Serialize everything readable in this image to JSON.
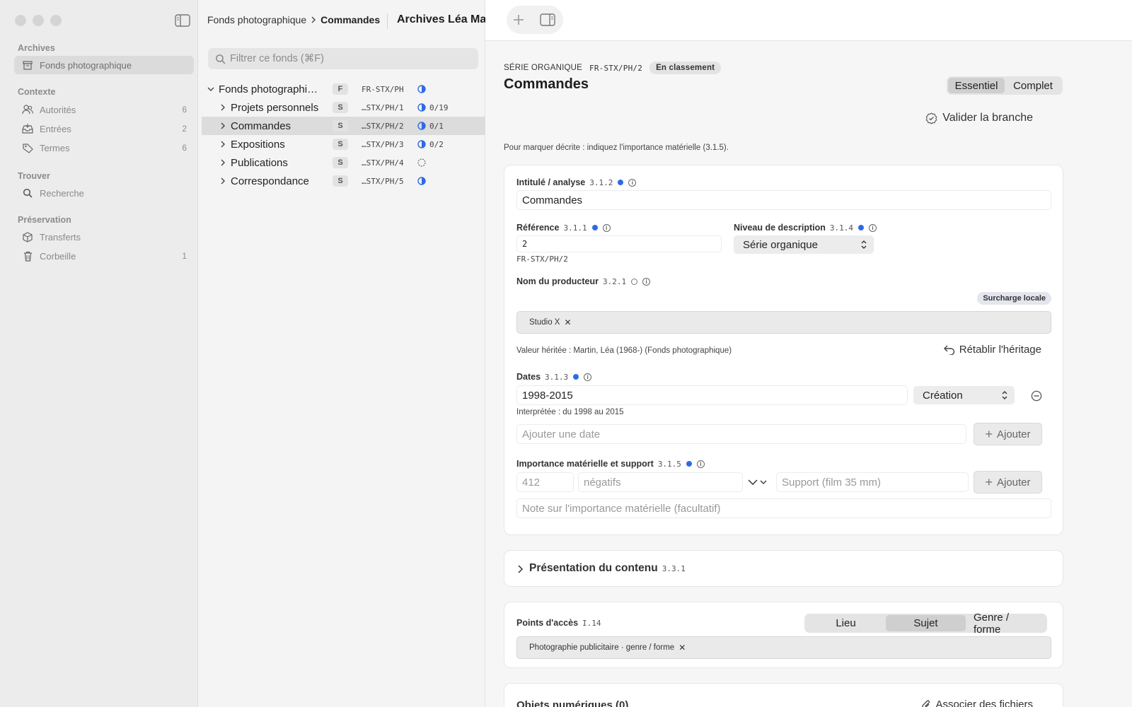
{
  "sidebar": {
    "sections": [
      {
        "heading": "Archives",
        "items": [
          {
            "label": "Fonds photographique",
            "icon": "archive-box-icon",
            "count": ""
          }
        ]
      },
      {
        "heading": "Contexte",
        "items": [
          {
            "label": "Autorités",
            "icon": "people-icon",
            "count": "6"
          },
          {
            "label": "Entrées",
            "icon": "inbox-tray-icon",
            "count": "2"
          },
          {
            "label": "Termes",
            "icon": "tag-icon",
            "count": "6"
          }
        ]
      },
      {
        "heading": "Trouver",
        "items": [
          {
            "label": "Recherche",
            "icon": "search-icon",
            "count": ""
          }
        ]
      },
      {
        "heading": "Préservation",
        "items": [
          {
            "label": "Transferts",
            "icon": "cube-icon",
            "count": ""
          },
          {
            "label": "Corbeille",
            "icon": "trash-icon",
            "count": "1"
          }
        ]
      }
    ]
  },
  "breadcrumb": {
    "parent": "Fonds photographique",
    "current": "Commandes"
  },
  "window_title": "Archives Léa Martin",
  "tree": {
    "search_placeholder": "Filtrer ce fonds (⌘F)",
    "rows": [
      {
        "name": "Fonds photographi…",
        "level": "F",
        "ref": "FR-STX/PH",
        "count": "",
        "progress": 0.5,
        "expanded": true
      },
      {
        "name": "Projets personnels",
        "level": "S",
        "ref": "…STX/PH/1",
        "count": "0/19",
        "progress": 0.5,
        "expanded": false
      },
      {
        "name": "Commandes",
        "level": "S",
        "ref": "…STX/PH/2",
        "count": "0/1",
        "progress": 0.5,
        "expanded": false,
        "selected": true
      },
      {
        "name": "Expositions",
        "level": "S",
        "ref": "…STX/PH/3",
        "count": "0/2",
        "progress": 0.5,
        "expanded": false
      },
      {
        "name": "Publications",
        "level": "S",
        "ref": "…STX/PH/4",
        "count": "",
        "progress": 0,
        "expanded": false
      },
      {
        "name": "Correspondance",
        "level": "S",
        "ref": "…STX/PH/5",
        "count": "",
        "progress": 0.5,
        "expanded": false
      }
    ]
  },
  "record": {
    "kind": "SÉRIE ORGANIQUE",
    "ref": "FR-STX/PH/2",
    "status": "En classement",
    "title": "Commandes",
    "view_modes": [
      "Essentiel",
      "Complet"
    ],
    "validate_label": "Valider la branche",
    "hint": "Pour marquer décrite : indiquez l'importance matérielle (3.1.5)."
  },
  "fields": {
    "title": {
      "label": "Intitulé / analyse",
      "num": "3.1.2",
      "value": "Commandes"
    },
    "reference": {
      "label": "Référence",
      "num": "3.1.1",
      "value": "2",
      "full": "FR-STX/PH/2"
    },
    "level": {
      "label": "Niveau de description",
      "num": "3.1.4",
      "value": "Série organique"
    },
    "producer": {
      "label": "Nom du producteur",
      "num": "3.2.1",
      "override": "Surcharge locale",
      "token": "Studio X",
      "inherited": "Valeur héritée : Martin, Léa (1968-) (Fonds photographique)",
      "restore": "Rétablir l'héritage"
    },
    "dates": {
      "label": "Dates",
      "num": "3.1.3",
      "value": "1998-2015",
      "type": "Création",
      "interpreted": "Interprétée : du 1998 au 2015",
      "add_placeholder": "Ajouter une date",
      "add_button": "Ajouter"
    },
    "extent": {
      "label": "Importance matérielle et support",
      "num": "3.1.5",
      "qty_placeholder": "412",
      "unit_placeholder": "négatifs",
      "support_placeholder": "Support (film 35 mm)",
      "add_button": "Ajouter",
      "note_placeholder": "Note sur l'importance matérielle (facultatif)"
    }
  },
  "presentation": {
    "label": "Présentation du contenu",
    "num": "3.3.1"
  },
  "access_points": {
    "label": "Points d'accès",
    "num": "I.14",
    "tabs": [
      "Lieu",
      "Sujet",
      "Genre / forme"
    ],
    "active_tab": 1,
    "token": "Photographie publicitaire · genre / forme"
  },
  "digital_objects": {
    "label": "Objets numériques (0)",
    "action": "Associer des fichiers"
  },
  "colors": {
    "accent_blue": "#2f6ae6",
    "sidebar_bg": "#ececec",
    "tree_bg": "#f4f4f4",
    "main_bg": "#f6f6f6"
  }
}
